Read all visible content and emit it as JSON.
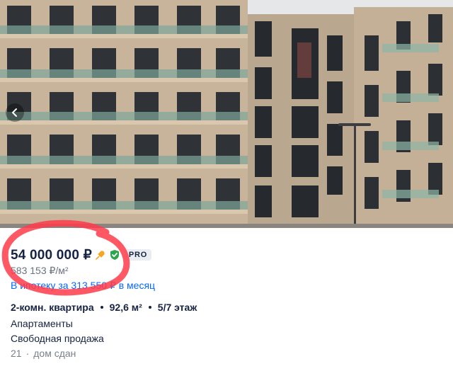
{
  "listing": {
    "price": "54 000 000 ₽",
    "price_per_meter": "583 153 ₽/м²",
    "mortgage": "В ипотеку за 313 550 ₽ в месяц",
    "pro_badge": "PRO",
    "specs": [
      "2-комн. квартира",
      "92,6 м²",
      "5/7 этаж"
    ],
    "type": "Апартаменты",
    "sale_type": "Свободная продажа",
    "status_number": "21",
    "status_separator": "·",
    "status_text": "дом сдан"
  },
  "icons": {
    "prev": "chevron-left-icon",
    "highlight": "rocket-icon",
    "verified": "shield-check-icon"
  },
  "colors": {
    "price_text": "#152242",
    "link": "#0468ff",
    "muted": "#6a7180",
    "highlight_orange": "#f5a623",
    "verified_green": "#2ea44f",
    "annotation_red": "#ff3b4a"
  }
}
